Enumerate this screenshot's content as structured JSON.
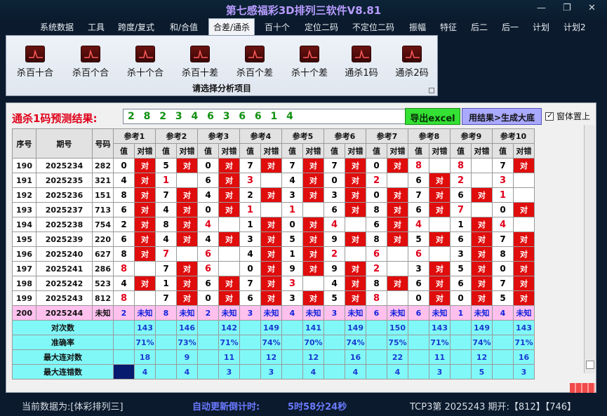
{
  "window": {
    "title": "第七感福彩3D排列三软件V8.81"
  },
  "menu": [
    "系统数据",
    "工具",
    "跨度/复式",
    "和/合值",
    "合差/通杀",
    "百十个",
    "定位二码",
    "不定位二码",
    "振幅",
    "特征",
    "后二",
    "后一",
    "计划",
    "计划2"
  ],
  "ribbon": {
    "buttons": [
      "杀百十合",
      "杀百个合",
      "杀十个合",
      "杀百十差",
      "杀百个差",
      "杀十个差",
      "通杀1码",
      "通杀2码"
    ],
    "caption": "请选择分析项目"
  },
  "prediction": {
    "label": "通杀1码预测结果:",
    "value": "2 8 2 3 4 6 3 6 6 1 4",
    "export_button": "导出excel",
    "generate_button": "用结果>生成大底",
    "topmost_label": "窗体置上"
  },
  "table": {
    "headers": {
      "seq": "序号",
      "issue": "期号",
      "code": "号码",
      "value": "值",
      "result": "对错"
    },
    "refs": [
      "参考1",
      "参考2",
      "参考3",
      "参考4",
      "参考5",
      "参考6",
      "参考7",
      "参考8",
      "参考9",
      "参考10"
    ],
    "rows": [
      {
        "seq": "190",
        "issue": "2025234",
        "code": "282",
        "vals": [
          "0",
          "5",
          "0",
          "7",
          "7",
          "7",
          "0",
          "8",
          "8",
          "7"
        ],
        "res": [
          "对",
          "对",
          "对",
          "对",
          "对",
          "对",
          "对",
          "",
          "",
          "对"
        ]
      },
      {
        "seq": "191",
        "issue": "2025235",
        "code": "321",
        "vals": [
          "4",
          "1",
          "6",
          "3",
          "4",
          "0",
          "2",
          "6",
          "2",
          "3"
        ],
        "res": [
          "对",
          "",
          "对",
          "",
          "对",
          "对",
          "",
          "对",
          "",
          ""
        ]
      },
      {
        "seq": "192",
        "issue": "2025236",
        "code": "151",
        "vals": [
          "8",
          "7",
          "4",
          "2",
          "3",
          "3",
          "0",
          "7",
          "6",
          "1"
        ],
        "res": [
          "对",
          "对",
          "对",
          "对",
          "对",
          "对",
          "对",
          "对",
          "对",
          ""
        ]
      },
      {
        "seq": "193",
        "issue": "2025237",
        "code": "713",
        "vals": [
          "6",
          "4",
          "0",
          "1",
          "1",
          "6",
          "8",
          "6",
          "7",
          "0"
        ],
        "res": [
          "对",
          "对",
          "对",
          "",
          "",
          "对",
          "对",
          "对",
          "",
          "对"
        ]
      },
      {
        "seq": "194",
        "issue": "2025238",
        "code": "754",
        "vals": [
          "2",
          "8",
          "4",
          "1",
          "0",
          "4",
          "6",
          "4",
          "1",
          "4"
        ],
        "res": [
          "对",
          "对",
          "",
          "对",
          "对",
          "",
          "对",
          "",
          "对",
          ""
        ]
      },
      {
        "seq": "195",
        "issue": "2025239",
        "code": "220",
        "vals": [
          "6",
          "4",
          "4",
          "3",
          "5",
          "9",
          "8",
          "5",
          "6",
          "7"
        ],
        "res": [
          "对",
          "对",
          "对",
          "对",
          "对",
          "对",
          "对",
          "对",
          "对",
          "对"
        ]
      },
      {
        "seq": "196",
        "issue": "2025240",
        "code": "627",
        "vals": [
          "8",
          "7",
          "6",
          "4",
          "1",
          "2",
          "6",
          "6",
          "3",
          "8"
        ],
        "res": [
          "对",
          "",
          "",
          "对",
          "对",
          "",
          "",
          "",
          "对",
          "对"
        ]
      },
      {
        "seq": "197",
        "issue": "2025241",
        "code": "286",
        "vals": [
          "8",
          "7",
          "6",
          "0",
          "9",
          "9",
          "2",
          "3",
          "5",
          "0"
        ],
        "res": [
          "",
          "对",
          "",
          "对",
          "对",
          "对",
          "",
          "对",
          "对",
          "对"
        ]
      },
      {
        "seq": "198",
        "issue": "2025242",
        "code": "523",
        "vals": [
          "4",
          "1",
          "6",
          "7",
          "3",
          "4",
          "8",
          "6",
          "6",
          "7"
        ],
        "res": [
          "对",
          "对",
          "对",
          "对",
          "",
          "对",
          "对",
          "对",
          "对",
          "对"
        ]
      },
      {
        "seq": "199",
        "issue": "2025243",
        "code": "812",
        "vals": [
          "8",
          "7",
          "0",
          "6",
          "3",
          "5",
          "8",
          "0",
          "0",
          "5"
        ],
        "res": [
          "",
          "对",
          "对",
          "对",
          "对",
          "对",
          "",
          "对",
          "对",
          "对"
        ]
      }
    ],
    "current": {
      "seq": "200",
      "issue": "2025244",
      "code": "未知",
      "vals": [
        "2",
        "8",
        "2",
        "3",
        "4",
        "3",
        "6",
        "6",
        "1",
        "4"
      ],
      "res_label": "未知"
    },
    "stats": [
      {
        "label": "对次数",
        "vals": [
          "143",
          "146",
          "142",
          "149",
          "141",
          "149",
          "150",
          "143",
          "149",
          "143"
        ]
      },
      {
        "label": "准确率",
        "vals": [
          "71%",
          "73%",
          "71%",
          "74%",
          "70%",
          "74%",
          "75%",
          "71%",
          "74%",
          "71%"
        ]
      },
      {
        "label": "最大连对数",
        "vals": [
          "18",
          "9",
          "11",
          "12",
          "12",
          "16",
          "22",
          "11",
          "12",
          "16"
        ]
      },
      {
        "label": "最大连错数",
        "vals": [
          "4",
          "4",
          "3",
          "3",
          "4",
          "4",
          "4",
          "3",
          "5",
          "3"
        ]
      }
    ]
  },
  "status": {
    "data_source": "当前数据为:[体彩排列三]",
    "countdown_label": "自动更新倒计时:",
    "countdown_value": "5时58分24秒",
    "latest": "TCP3第 2025243 期开:【812】【746】"
  },
  "colors": {
    "hit": "#e00d0d",
    "pending": "#ffc0ee",
    "stats": "#80f8f8",
    "export": "#33e033",
    "generate": "#a9a9ff"
  }
}
